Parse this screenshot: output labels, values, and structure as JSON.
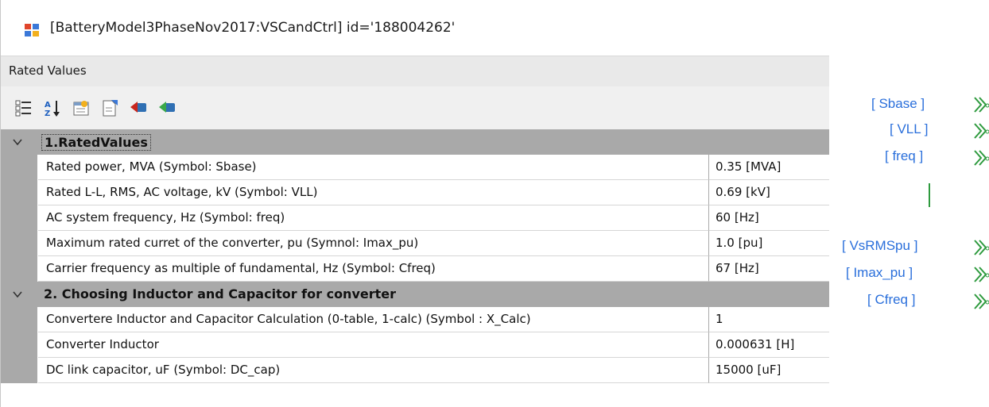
{
  "window": {
    "title": "[BatteryModel3PhaseNov2017:VSCandCtrl] id='188004262'",
    "section": "Rated Values"
  },
  "toolbar": {
    "icons": [
      "categorized-icon",
      "alphabetical-sort-icon",
      "property-pages-icon",
      "export-icon",
      "import-icon",
      "apply-icon"
    ]
  },
  "categories": [
    {
      "label": "1.RatedValues",
      "rows": [
        {
          "name": "Rated power,  MVA (Symbol: Sbase)",
          "value": "0.35 [MVA]"
        },
        {
          "name": "Rated L-L, RMS, AC voltage, kV (Symbol: VLL)",
          "value": "0.69 [kV]"
        },
        {
          "name": "AC system frequency, Hz (Symbol: freq)",
          "value": "60 [Hz]"
        },
        {
          "name": "Maximum rated curret of the converter, pu (Symnol: Imax_pu)",
          "value": "1.0 [pu]"
        },
        {
          "name": "Carrier frequency as multiple of fundamental, Hz (Symbol: Cfreq)",
          "value": "67 [Hz]"
        }
      ]
    },
    {
      "label": "2. Choosing Inductor and Capacitor for converter",
      "rows": [
        {
          "name": "Convertere Inductor and Capacitor Calculation (0-table, 1-calc)  (Symbol : X_Calc)",
          "value": "1"
        },
        {
          "name": "Converter Inductor",
          "value": "0.000631 [H]"
        },
        {
          "name": "DC link capacitor, uF (Symbol: DC_cap)",
          "value": "15000 [uF]"
        }
      ]
    }
  ],
  "schematic": {
    "tags": [
      "[ Sbase ]",
      "[ VLL ]",
      "[ freq ]",
      "[ VsRMSpu ]",
      "[ Imax_pu ]",
      "[ Cfreq ]"
    ],
    "tag_color": "#2a6fdb",
    "connector_color": "#2e9a3e"
  }
}
